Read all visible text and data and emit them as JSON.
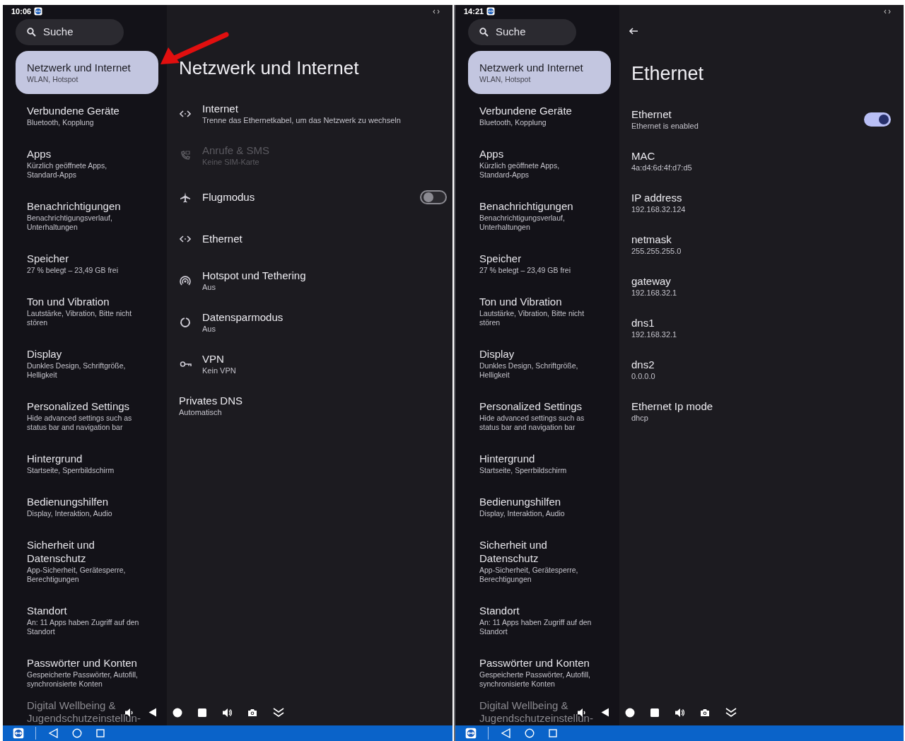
{
  "screens": [
    {
      "status_bar": {
        "time": "10:06"
      },
      "search": {
        "placeholder": "Suche"
      },
      "sidebar": {
        "items": [
          {
            "title": "Netzwerk und Internet",
            "subtitle": "WLAN, Hotspot",
            "selected": true
          },
          {
            "title": "Verbundene Geräte",
            "subtitle": "Bluetooth, Kopplung",
            "selected": false
          },
          {
            "title": "Apps",
            "subtitle": "Kürzlich geöffnete Apps, Standard-Apps",
            "selected": false
          },
          {
            "title": "Benachrichtigungen",
            "subtitle": "Benachrichtigungsverlauf, Unterhaltungen",
            "selected": false
          },
          {
            "title": "Speicher",
            "subtitle": "27 % belegt – 23,49 GB frei",
            "selected": false
          },
          {
            "title": "Ton und Vibration",
            "subtitle": "Lautstärke, Vibration, Bitte nicht stören",
            "selected": false
          },
          {
            "title": "Display",
            "subtitle": "Dunkles Design, Schriftgröße, Helligkeit",
            "selected": false
          },
          {
            "title": "Personalized Settings",
            "subtitle": "Hide advanced settings such as status bar and navigation bar",
            "selected": false
          },
          {
            "title": "Hintergrund",
            "subtitle": "Startseite, Sperrbildschirm",
            "selected": false
          },
          {
            "title": "Bedienungshilfen",
            "subtitle": "Display, Interaktion, Audio",
            "selected": false
          },
          {
            "title": "Sicherheit und Datenschutz",
            "subtitle": "App-Sicherheit, Gerätesperre, Berechtigungen",
            "selected": false
          },
          {
            "title": "Standort",
            "subtitle": "An: 11 Apps haben Zugriff auf den Standort",
            "selected": false
          },
          {
            "title": "Passwörter und Konten",
            "subtitle": "Gespeicherte Passwörter, Autofill, synchronisierte Konten",
            "selected": false
          }
        ],
        "last_item": {
          "title": "Digital Wellbeing & Jugendschutzeinstellun-"
        }
      },
      "page": {
        "kind": "list",
        "title": "Netzwerk und Internet",
        "items": [
          {
            "title": "Internet",
            "subtitle": "Trenne das Ethernetkabel, um das Netzwerk zu wechseln",
            "disabled": false
          },
          {
            "title": "Anrufe & SMS",
            "subtitle": "Keine SIM-Karte",
            "disabled": true
          },
          {
            "title": "Flugmodus",
            "disabled": false,
            "on": false
          },
          {
            "title": "Ethernet",
            "disabled": false
          },
          {
            "title": "Hotspot und Tethering",
            "subtitle": "Aus",
            "disabled": false
          },
          {
            "title": "Datensparmodus",
            "subtitle": "Aus",
            "disabled": false
          },
          {
            "title": "VPN",
            "subtitle": "Kein VPN",
            "disabled": false
          },
          {
            "title": "Privates DNS",
            "subtitle": "Automatisch",
            "disabled": false
          }
        ]
      }
    },
    {
      "status_bar": {
        "time": "14:21"
      },
      "search": {
        "placeholder": "Suche"
      },
      "sidebar": {
        "items": [
          {
            "title": "Netzwerk und Internet",
            "subtitle": "WLAN, Hotspot",
            "selected": true
          },
          {
            "title": "Verbundene Geräte",
            "subtitle": "Bluetooth, Kopplung",
            "selected": false
          },
          {
            "title": "Apps",
            "subtitle": "Kürzlich geöffnete Apps, Standard-Apps",
            "selected": false
          },
          {
            "title": "Benachrichtigungen",
            "subtitle": "Benachrichtigungsverlauf, Unterhaltungen",
            "selected": false
          },
          {
            "title": "Speicher",
            "subtitle": "27 % belegt – 23,49 GB frei",
            "selected": false
          },
          {
            "title": "Ton und Vibration",
            "subtitle": "Lautstärke, Vibration, Bitte nicht stören",
            "selected": false
          },
          {
            "title": "Display",
            "subtitle": "Dunkles Design, Schriftgröße, Helligkeit",
            "selected": false
          },
          {
            "title": "Personalized Settings",
            "subtitle": "Hide advanced settings such as status bar and navigation bar",
            "selected": false
          },
          {
            "title": "Hintergrund",
            "subtitle": "Startseite, Sperrbildschirm",
            "selected": false
          },
          {
            "title": "Bedienungshilfen",
            "subtitle": "Display, Interaktion, Audio",
            "selected": false
          },
          {
            "title": "Sicherheit und Datenschutz",
            "subtitle": "App-Sicherheit, Gerätesperre, Berechtigungen",
            "selected": false
          },
          {
            "title": "Standort",
            "subtitle": "An: 11 Apps haben Zugriff auf den Standort",
            "selected": false
          },
          {
            "title": "Passwörter und Konten",
            "subtitle": "Gespeicherte Passwörter, Autofill, synchronisierte Konten",
            "selected": false
          }
        ],
        "last_item": {
          "title": "Digital Wellbeing & Jugendschutzeinstellun-"
        }
      },
      "page": {
        "kind": "detail",
        "title": "Ethernet",
        "items": [
          {
            "title": "Ethernet",
            "subtitle": "Ethernet is enabled",
            "on": true
          },
          {
            "title": "MAC",
            "subtitle": "4a:d4:6d:4f:d7:d5"
          },
          {
            "title": "IP address",
            "subtitle": "192.168.32.124"
          },
          {
            "title": "netmask",
            "subtitle": "255.255.255.0"
          },
          {
            "title": "gateway",
            "subtitle": "192.168.32.1"
          },
          {
            "title": "dns1",
            "subtitle": "192.168.32.1"
          },
          {
            "title": "dns2",
            "subtitle": "0.0.0.0"
          },
          {
            "title": "Ethernet Ip mode",
            "subtitle": "dhcp"
          }
        ]
      }
    }
  ]
}
